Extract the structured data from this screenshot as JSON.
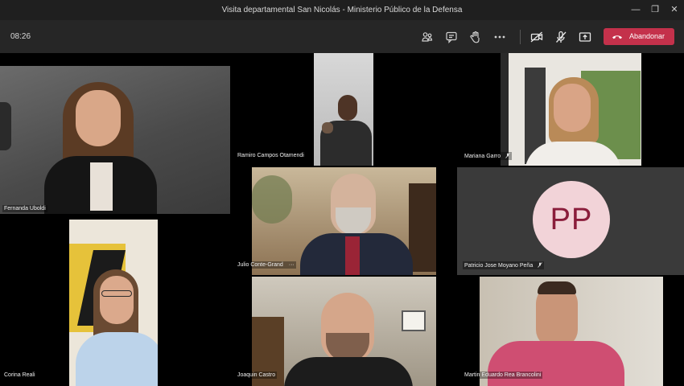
{
  "window": {
    "title": "Visita departamental San Nicolás - Ministerio Público de la Defensa"
  },
  "toolbar": {
    "clock": "08:26",
    "leave_label": "Abandonar"
  },
  "participants": {
    "p1": "Fernanda Uboldi",
    "p2": "Ramiro Campos Otamendi",
    "p3": "Mariana Garro",
    "p4": "Julio Conte-Grand",
    "p4_more": "···",
    "p5": "Patricio Jose Moyano Peña",
    "p5_initials": "PP",
    "p6": "Corina Reali",
    "p7": "Joaquin Castro",
    "p8": "Martin Eduardo Rea Brancolini"
  },
  "colors": {
    "leave": "#c4314b",
    "avatar_bg": "#f2d3d8",
    "avatar_fg": "#8a1d3b"
  }
}
